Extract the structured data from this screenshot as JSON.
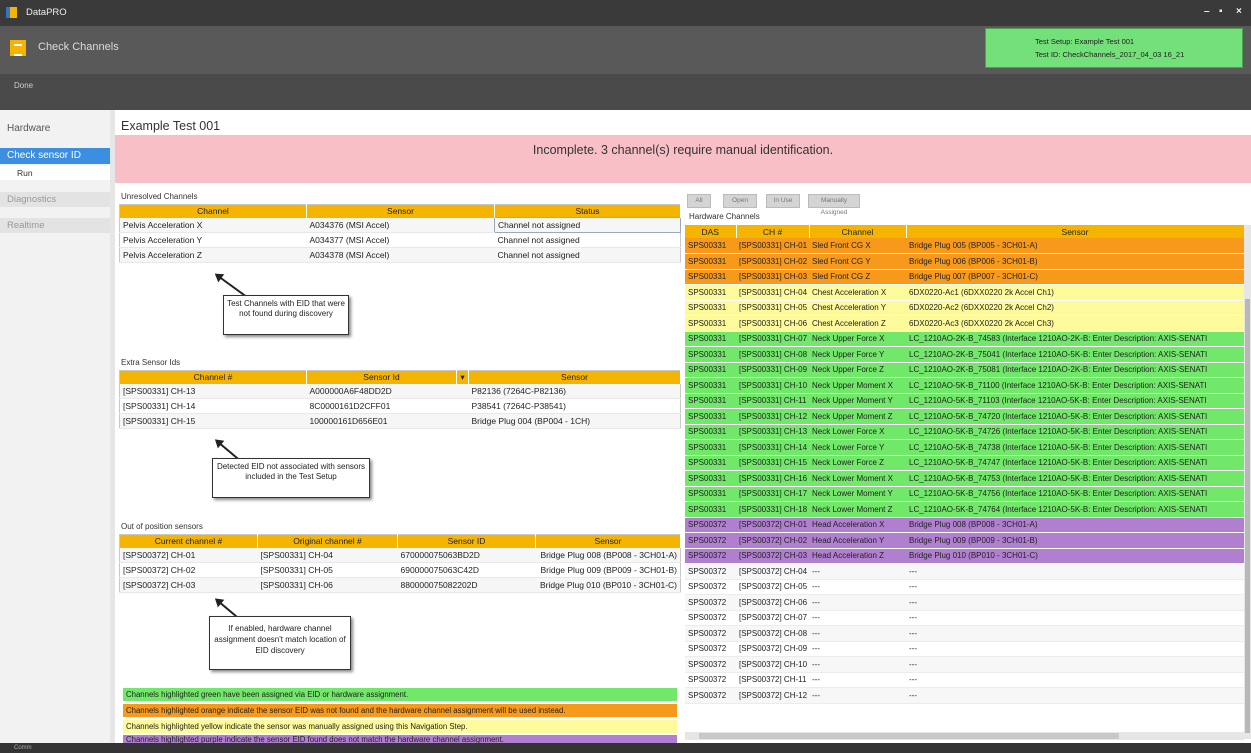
{
  "app": {
    "name": "DataPRO",
    "controls": {
      "minimize": "–",
      "maximize": "▪",
      "close": "×"
    }
  },
  "header": {
    "title": "Check Channels",
    "test_setup": "Test Setup: Example Test 001",
    "test_id": "Test ID: CheckChannels_2017_04_03 16_21"
  },
  "toolbar": {
    "done": "Done"
  },
  "nav": {
    "hardware": "Hardware",
    "check_sensor_id": "Check sensor ID",
    "run": "Run",
    "diagnostics": "Diagnostics",
    "realtime": "Realtime"
  },
  "main": {
    "test_title": "Example Test 001",
    "banner": "Incomplete. 3 channel(s) require manual identification."
  },
  "unresolved": {
    "title": "Unresolved Channels",
    "headers": [
      "Channel",
      "Sensor",
      "Status"
    ],
    "rows": [
      [
        "Pelvis Acceleration X",
        "A034376 (MSI Accel)",
        "Channel not assigned"
      ],
      [
        "Pelvis Acceleration Y",
        "A034377 (MSI Accel)",
        "Channel not assigned"
      ],
      [
        "Pelvis Acceleration Z",
        "A034378 (MSI Accel)",
        "Channel not assigned"
      ]
    ],
    "note": "Test Channels with EID that were not found during discovery"
  },
  "extra": {
    "title": "Extra Sensor Ids",
    "headers": [
      "Channel #",
      "Sensor Id",
      "▾",
      "Sensor"
    ],
    "rows": [
      [
        "[SPS00331] CH-13",
        "A000000A6F48DD2D",
        "P82136 (7264C-P82136)"
      ],
      [
        "[SPS00331] CH-14",
        "8C0000161D2CFF01",
        "P38541 (7264C-P38541)"
      ],
      [
        "[SPS00331] CH-15",
        "100000161D656E01",
        "Bridge Plug 004 (BP004 - 1CH)"
      ]
    ],
    "note": "Detected EID not associated with sensors included in the Test Setup"
  },
  "outpos": {
    "title": "Out of position sensors",
    "headers": [
      "Current channel #",
      "Original channel #",
      "Sensor ID",
      "Sensor"
    ],
    "rows": [
      [
        "[SPS00372] CH-01",
        "[SPS00331] CH-04",
        "670000075063BD2D",
        "Bridge Plug 008 (BP008 - 3CH01-A)"
      ],
      [
        "[SPS00372] CH-02",
        "[SPS00331] CH-05",
        "690000075063C42D",
        "Bridge Plug 009 (BP009 - 3CH01-B)"
      ],
      [
        "[SPS00372] CH-03",
        "[SPS00331] CH-06",
        "880000075082202D",
        "Bridge Plug 010 (BP010 - 3CH01-C)"
      ]
    ],
    "note": "If enabled, hardware channel assignment doesn't match location of EID discovery"
  },
  "legend": {
    "green": "Channels highlighted green have been assigned via EID or hardware assignment.",
    "orange": "Channels highlighted orange indicate the sensor EID was not found and the hardware channel assignment will be used instead.",
    "yellow": "Channels highlighted yellow indicate the sensor was manually assigned using this Navigation Step.",
    "purple": "Channels highlighted purple indicate the sensor EID found does not match the hardware channel assignment."
  },
  "filters": [
    "All",
    "Open",
    "In Use",
    "Manually Assigned"
  ],
  "hardware": {
    "title": "Hardware Channels",
    "headers": [
      "DAS",
      "CH #",
      "Channel",
      "Sensor"
    ],
    "rows": [
      [
        "SPS00331",
        "[SPS00331] CH-01",
        "Sled Front CG X",
        "Bridge Plug 005 (BP005 - 3CH01-A)",
        "orange"
      ],
      [
        "SPS00331",
        "[SPS00331] CH-02",
        "Sled Front CG Y",
        "Bridge Plug 006 (BP006 - 3CH01-B)",
        "orange"
      ],
      [
        "SPS00331",
        "[SPS00331] CH-03",
        "Sled Front CG Z",
        "Bridge Plug 007 (BP007 - 3CH01-C)",
        "orange"
      ],
      [
        "SPS00331",
        "[SPS00331] CH-04",
        "Chest Acceleration X",
        "6DX0220-Ac1 (6DXX0220 2k Accel Ch1)",
        "yellow"
      ],
      [
        "SPS00331",
        "[SPS00331] CH-05",
        "Chest Acceleration Y",
        "6DX0220-Ac2 (6DXX0220 2k Accel Ch2)",
        "yellow"
      ],
      [
        "SPS00331",
        "[SPS00331] CH-06",
        "Chest Acceleration Z",
        "6DX0220-Ac3 (6DXX0220 2k Accel Ch3)",
        "yellow"
      ],
      [
        "SPS00331",
        "[SPS00331] CH-07",
        "Neck Upper Force X",
        "LC_1210AO-2K-B_74583 (Interface 1210AO-2K-B: Enter Description: AXIS-SENATI",
        "green"
      ],
      [
        "SPS00331",
        "[SPS00331] CH-08",
        "Neck Upper Force Y",
        "LC_1210AO-2K-B_75041 (Interface 1210AO-5K-B: Enter Description: AXIS-SENATI",
        "green"
      ],
      [
        "SPS00331",
        "[SPS00331] CH-09",
        "Neck Upper Force Z",
        "LC_1210AO-2K-B_75081 (Interface 1210AO-2K-B: Enter Description: AXIS-SENATI",
        "green"
      ],
      [
        "SPS00331",
        "[SPS00331] CH-10",
        "Neck Upper Moment X",
        "LC_1210AO-5K-B_71100 (Interface 1210AO-5K-B: Enter Description: AXIS-SENATI",
        "green"
      ],
      [
        "SPS00331",
        "[SPS00331] CH-11",
        "Neck Upper Moment Y",
        "LC_1210AO-5K-B_71103 (Interface 1210AO-5K-B: Enter Description: AXIS-SENATI",
        "green"
      ],
      [
        "SPS00331",
        "[SPS00331] CH-12",
        "Neck Upper Moment Z",
        "LC_1210AO-5K-B_74720 (Interface 1210AO-5K-B: Enter Description: AXIS-SENATI",
        "green"
      ],
      [
        "SPS00331",
        "[SPS00331] CH-13",
        "Neck Lower Force X",
        "LC_1210AO-5K-B_74726 (Interface 1210AO-5K-B: Enter Description: AXIS-SENATI",
        "green"
      ],
      [
        "SPS00331",
        "[SPS00331] CH-14",
        "Neck Lower Force Y",
        "LC_1210AO-5K-B_74738 (Interface 1210AO-5K-B: Enter Description: AXIS-SENATI",
        "green"
      ],
      [
        "SPS00331",
        "[SPS00331] CH-15",
        "Neck Lower Force Z",
        "LC_1210AO-5K-B_74747 (Interface 1210AO-5K-B: Enter Description: AXIS-SENATI",
        "green"
      ],
      [
        "SPS00331",
        "[SPS00331] CH-16",
        "Neck Lower Moment X",
        "LC_1210AO-5K-B_74753 (Interface 1210AO-5K-B: Enter Description: AXIS-SENATI",
        "green"
      ],
      [
        "SPS00331",
        "[SPS00331] CH-17",
        "Neck Lower Moment Y",
        "LC_1210AO-5K-B_74756 (Interface 1210AO-5K-B: Enter Description: AXIS-SENATI",
        "green"
      ],
      [
        "SPS00331",
        "[SPS00331] CH-18",
        "Neck Lower Moment Z",
        "LC_1210AO-5K-B_74764 (Interface 1210AO-5K-B: Enter Description: AXIS-SENATI",
        "green"
      ],
      [
        "SPS00372",
        "[SPS00372] CH-01",
        "Head Acceleration X",
        "Bridge Plug 008 (BP008 - 3CH01-A)",
        "purple"
      ],
      [
        "SPS00372",
        "[SPS00372] CH-02",
        "Head Acceleration Y",
        "Bridge Plug 009 (BP009 - 3CH01-B)",
        "purple"
      ],
      [
        "SPS00372",
        "[SPS00372] CH-03",
        "Head Acceleration Z",
        "Bridge Plug 010 (BP010 - 3CH01-C)",
        "purple"
      ],
      [
        "SPS00372",
        "[SPS00372] CH-04",
        "---",
        "---",
        "plain"
      ],
      [
        "SPS00372",
        "[SPS00372] CH-05",
        "---",
        "---",
        "plain"
      ],
      [
        "SPS00372",
        "[SPS00372] CH-06",
        "---",
        "---",
        "plain"
      ],
      [
        "SPS00372",
        "[SPS00372] CH-07",
        "---",
        "---",
        "plain"
      ],
      [
        "SPS00372",
        "[SPS00372] CH-08",
        "---",
        "---",
        "plain"
      ],
      [
        "SPS00372",
        "[SPS00372] CH-09",
        "---",
        "---",
        "plain"
      ],
      [
        "SPS00372",
        "[SPS00372] CH-10",
        "---",
        "---",
        "plain"
      ],
      [
        "SPS00372",
        "[SPS00372] CH-11",
        "---",
        "---",
        "plain"
      ],
      [
        "SPS00372",
        "[SPS00372] CH-12",
        "---",
        "---",
        "plain"
      ]
    ]
  },
  "status": {
    "text": "Comm"
  },
  "colors": {
    "orange": "#f79a1c",
    "yellow": "#fdfa9b",
    "green": "#72e86a",
    "purple": "#b17fd0",
    "header": "#f4b400",
    "banner": "#f8c0c6",
    "accent": "#3c8ee0"
  }
}
